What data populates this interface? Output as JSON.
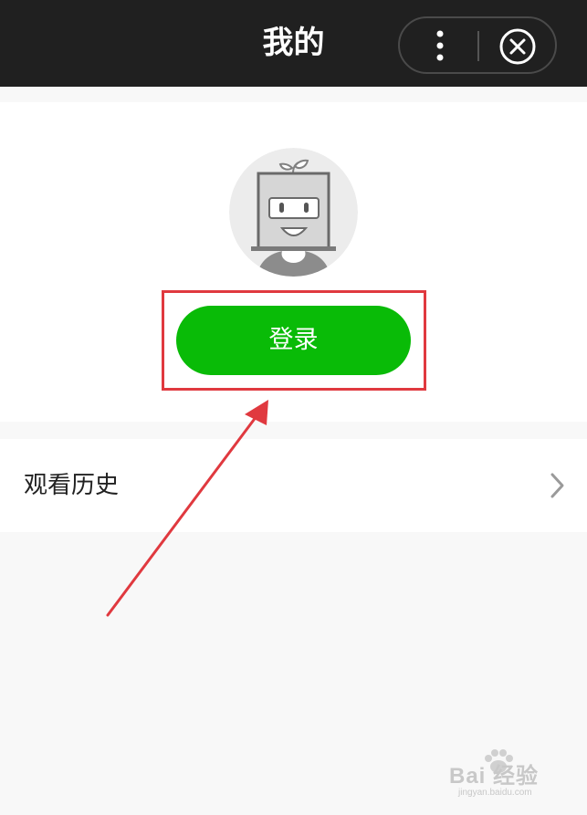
{
  "header": {
    "title": "我的",
    "menu_icon": "more-vertical-icon",
    "close_icon": "close-circle-icon"
  },
  "profile": {
    "avatar_icon": "default-avatar-icon",
    "login_label": "登录"
  },
  "menu": {
    "items": [
      {
        "label": "观看历史",
        "icon": "chevron-right-icon"
      }
    ]
  },
  "watermark": {
    "main": "Bai  经验",
    "sub": "jingyan.baidu.com"
  },
  "colors": {
    "topbar": "#202020",
    "accent_green": "#09bb07",
    "annotation_red": "#e0393f",
    "background": "#f8f8f8"
  }
}
